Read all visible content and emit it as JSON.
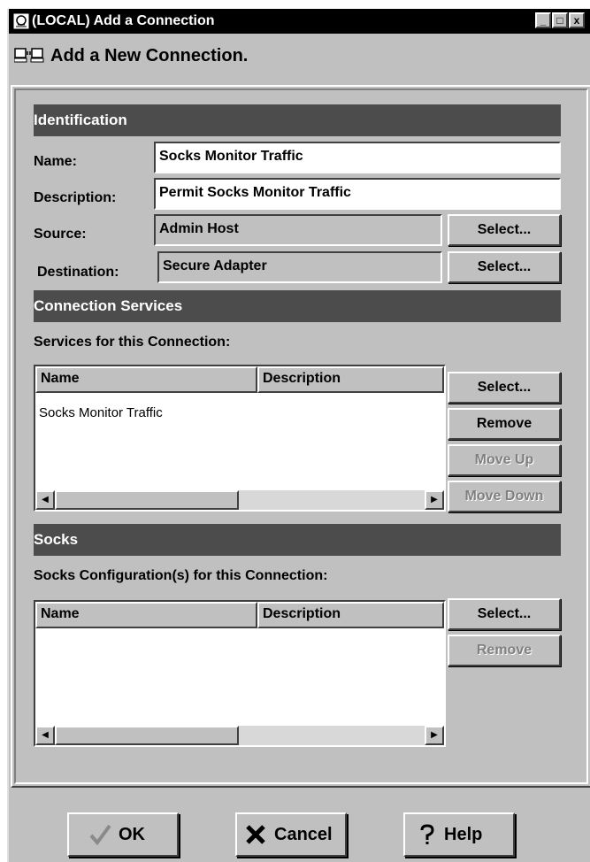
{
  "window": {
    "title": "(LOCAL) Add a Connection",
    "controls": [
      "_",
      "□",
      "x"
    ]
  },
  "header": {
    "title": "Add a New Connection."
  },
  "identification": {
    "heading": "Identification",
    "name_label": "Name:",
    "name_value": "Socks Monitor Traffic",
    "desc_label": "Description:",
    "desc_value": "Permit Socks Monitor Traffic",
    "source_label": "Source:",
    "source_value": "Admin Host",
    "dest_label": "Destination:",
    "dest_value": "Secure Adapter",
    "select_label": "Select..."
  },
  "services": {
    "heading": "Connection Services",
    "list_label": "Services for this Connection:",
    "columns": [
      "Name",
      "Description"
    ],
    "rows": [
      {
        "name": "Socks Monitor Traffic",
        "description": ""
      }
    ],
    "buttons": {
      "select": "Select...",
      "remove": "Remove",
      "move_up": "Move Up",
      "move_down": "Move Down"
    }
  },
  "socks": {
    "heading": "Socks",
    "list_label": "Socks Configuration(s) for this Connection:",
    "columns": [
      "Name",
      "Description"
    ],
    "buttons": {
      "select": "Select...",
      "remove": "Remove"
    }
  },
  "footer": {
    "ok": "OK",
    "cancel": "Cancel",
    "help": "Help"
  }
}
